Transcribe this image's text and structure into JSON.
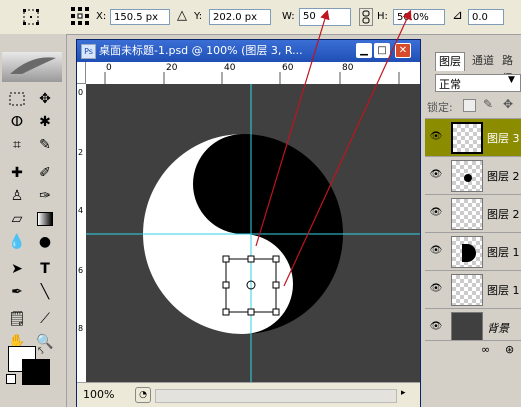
{
  "options_bar": {
    "x_label": "X:",
    "x_value": "150.5 px",
    "delta_symbol": "△",
    "y_label": "Y:",
    "y_value": "202.0 px",
    "w_label": "W:",
    "w_value": "50",
    "h_label": "H:",
    "h_value": "50.0%",
    "angle_symbol": "⊿",
    "angle_value": "0.0"
  },
  "document": {
    "title": "桌面未标题-1.psd @ 100% (图层 3, R...",
    "zoom": "100%",
    "ruler_top": [
      "0",
      "20",
      "40",
      "60",
      "80"
    ],
    "ruler_left": [
      "0",
      "2",
      "4",
      "6",
      "8"
    ]
  },
  "layers_panel": {
    "tabs": [
      "图层",
      "通道",
      "路径"
    ],
    "blend_mode": "正常",
    "lock_label": "锁定:",
    "layers": [
      {
        "name": "图层 3",
        "selected": true
      },
      {
        "name": "图层 2"
      },
      {
        "name": "图层 2"
      },
      {
        "name": "图层 1"
      },
      {
        "name": "图层 1"
      },
      {
        "name": "背景"
      }
    ]
  },
  "colors": {
    "title_bar": "#1f4fb5",
    "selected_layer": "#8c8c00",
    "guide": "#2fd5e6",
    "arrow": "#c0141e"
  }
}
